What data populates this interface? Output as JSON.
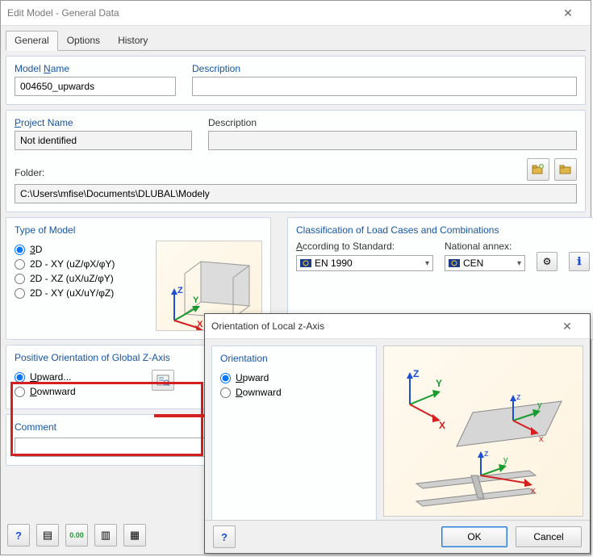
{
  "window": {
    "title": "Edit Model - General Data",
    "close": "✕"
  },
  "tabs": {
    "general": "General",
    "options": "Options",
    "history": "History"
  },
  "modelName": {
    "label_pre": "Model ",
    "label_key": "N",
    "label_post": "ame",
    "value": "004650_upwards"
  },
  "description1": {
    "label": "Description",
    "value": ""
  },
  "projectName": {
    "label_key": "P",
    "label_post": "roject Name",
    "value": "Not identified"
  },
  "description2": {
    "label": "Description",
    "value": ""
  },
  "folder": {
    "label": "Folder:",
    "value": "C:\\Users\\mfise\\Documents\\DLUBAL\\Modely"
  },
  "typeOfModel": {
    "title": "Type of Model",
    "opt3d_key": "3",
    "opt3d_post": "D",
    "opt2d_xy_uz": "2D - XY (uZ/φX/φY)",
    "opt2d_xz": "2D - XZ (uX/uZ/φY)",
    "opt2d_xy_ux": "2D - XY (uX/uY/φZ)"
  },
  "classification": {
    "title": "Classification of Load Cases and Combinations",
    "std_label_key": "A",
    "std_label_post": "ccording to Standard:",
    "annex_label": "National annex:",
    "std_value": "EN 1990",
    "annex_value": "CEN"
  },
  "orientation": {
    "title": "Positive Orientation of Global Z-Axis",
    "up_key": "U",
    "up_post": "pward...",
    "down_key": "D",
    "down_post": "ownward"
  },
  "comment": {
    "title": "Comment",
    "value": ""
  },
  "buttons": {
    "ok": "OK",
    "cancel": "Cancel"
  },
  "popup": {
    "title": "Orientation of Local z-Axis",
    "close": "✕",
    "grp": "Orientation",
    "up_key": "U",
    "up_post": "pward",
    "down_key": "D",
    "down_post": "ownward",
    "ok": "OK",
    "cancel": "Cancel"
  }
}
